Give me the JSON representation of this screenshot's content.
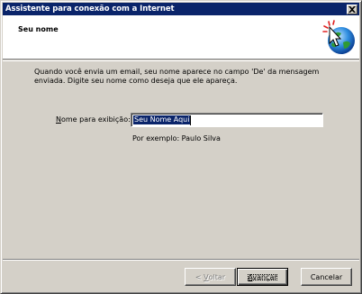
{
  "window": {
    "title": "Assistente para conexão com a Internet",
    "close_icon": "close-icon"
  },
  "header": {
    "title": "Seu nome",
    "icon": "internet-connection-wizard-icon"
  },
  "body": {
    "intro": "Quando você envia um email, seu nome aparece no campo 'De' da mensagem\nenviada. Digite seu nome como deseja que ele apareça.",
    "field": {
      "label_accel": "N",
      "label_rest": "ome para exibição:",
      "value": "Seu Nome Aqui"
    },
    "example": "Por exemplo: Paulo Silva"
  },
  "buttons": {
    "back_lt": "< ",
    "back_accel": "V",
    "back_rest": "oltar",
    "next_accel": "A",
    "next_rest": "vançar",
    "cancel": "Cancelar"
  },
  "colors": {
    "titlebar": "#0a246a",
    "face": "#d4d0c8",
    "selection": "#0a246a"
  }
}
